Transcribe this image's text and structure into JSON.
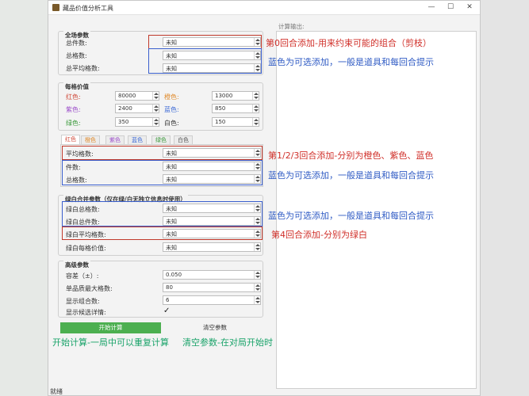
{
  "window": {
    "title": "藏品价值分析工具",
    "minimize": "—",
    "maximize": "☐",
    "close": "✕"
  },
  "global_group": {
    "title": "全场参数",
    "rows": [
      {
        "label": "总件数:",
        "value": "未知"
      },
      {
        "label": "总格数:",
        "value": "未知"
      },
      {
        "label": "总平均格数:",
        "value": "未知"
      }
    ]
  },
  "cell_value_group": {
    "title": "每格价值",
    "rows": [
      {
        "label": "红色:",
        "value": "80000",
        "color": "#d04a3a"
      },
      {
        "label": "橙色:",
        "value": "13000",
        "color": "#e08a2a"
      },
      {
        "label": "紫色:",
        "value": "2400",
        "color": "#9b4cc9"
      },
      {
        "label": "蓝色:",
        "value": "850",
        "color": "#3d6ad6"
      },
      {
        "label": "绿色:",
        "value": "350",
        "color": "#3b9a3b"
      },
      {
        "label": "白色:",
        "value": "150",
        "color": "#333333"
      }
    ]
  },
  "tabs": [
    {
      "label": "红色",
      "color": "#d04a3a"
    },
    {
      "label": "橙色",
      "color": "#e08a2a"
    },
    {
      "label": "紫色",
      "color": "#9b4cc9"
    },
    {
      "label": "蓝色",
      "color": "#3d6ad6"
    },
    {
      "label": "绿色",
      "color": "#3b9a3b"
    },
    {
      "label": "白色",
      "color": "#555555"
    }
  ],
  "tab_fields": [
    {
      "label": "平均格数:",
      "value": "未知"
    },
    {
      "label": "件数:",
      "value": "未知"
    },
    {
      "label": "总格数:",
      "value": "未知"
    }
  ],
  "gw_group": {
    "title": "绿白合并参数（仅在绿/白无独立信息时使用）",
    "rows": [
      {
        "label": "绿白总格数:",
        "value": "未知"
      },
      {
        "label": "绿白总件数:",
        "value": "未知"
      },
      {
        "label": "绿白平均格数:",
        "value": "未知"
      },
      {
        "label": "绿白每格价值:",
        "value": "未知"
      }
    ]
  },
  "advanced_group": {
    "title": "高级参数",
    "rows": [
      {
        "label": "容差（±）:",
        "value": "0.050"
      },
      {
        "label": "单品质最大格数:",
        "value": "80"
      },
      {
        "label": "显示组合数:",
        "value": "6"
      }
    ],
    "checkbox_label": "显示候选详情:",
    "checkbox_mark": "✓"
  },
  "buttons": {
    "start": "开始计算",
    "clear": "清空参数"
  },
  "output": {
    "label": "计算输出:"
  },
  "status": "就绪",
  "annotations": {
    "a1": "第0回合添加-用来约束可能的组合（剪枝）",
    "a2": "蓝色为可选添加，一般是道具和每回合提示",
    "a3": "第1/2/3回合添加-分别为橙色、紫色、蓝色",
    "a4": "蓝色为可选添加，一般是道具和每回合提示",
    "a5": "蓝色为可选添加，一般是道具和每回合提示",
    "a6": "第4回合添加-分别为绿白",
    "a7": "开始计算-一局中可以重复计算",
    "a8": "清空参数-在对局开始时"
  },
  "colors": {
    "red_box": "#c0392b",
    "blue_box": "#3a5fcd",
    "annot_red": "#d0302a",
    "annot_blue": "#2f5bc4",
    "annot_green": "#1aa36a",
    "button_green": "#4caf50"
  }
}
